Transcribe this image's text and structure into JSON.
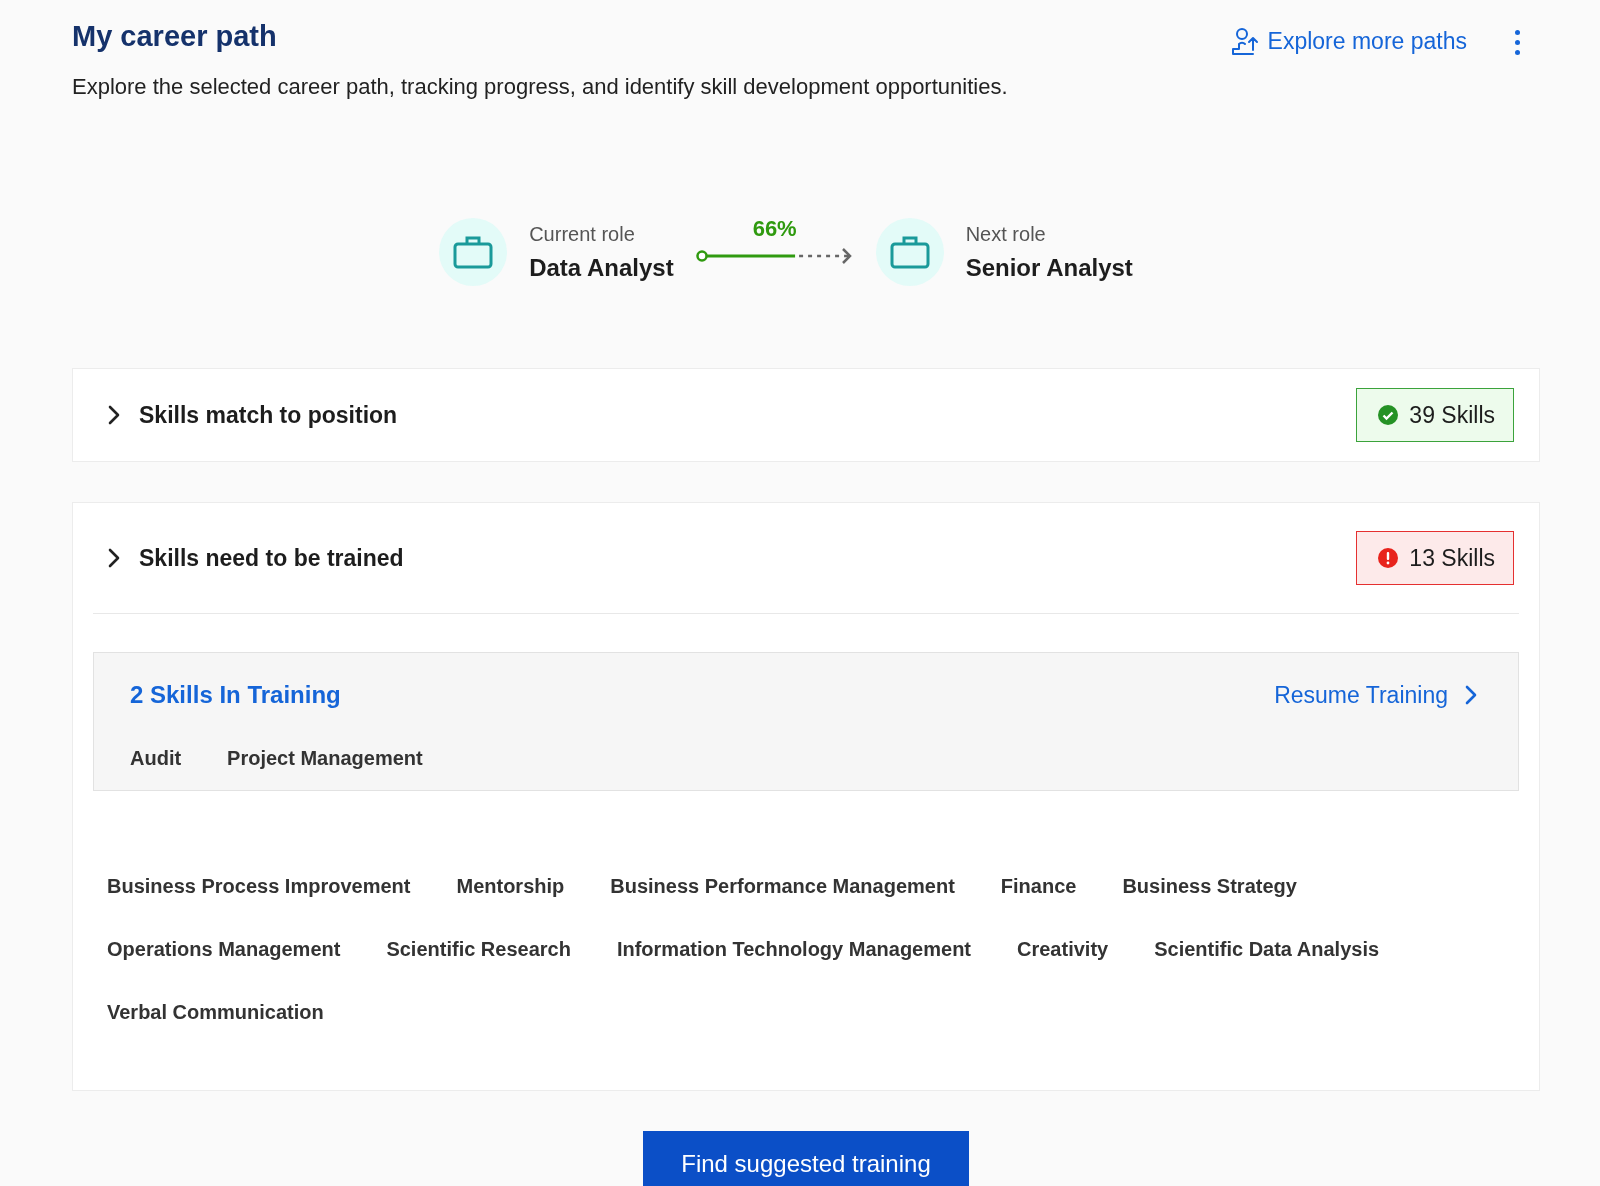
{
  "header": {
    "title": "My career path",
    "subtitle": "Explore the selected career path, tracking progress, and identify skill development opportunities.",
    "explore_link": "Explore more paths"
  },
  "path": {
    "current": {
      "label": "Current role",
      "title": "Data Analyst"
    },
    "progress": {
      "reading": "66%",
      "level": 0.66
    },
    "next": {
      "label": "Next role",
      "title": "Senior Analyst"
    }
  },
  "sections": [
    {
      "title": "Skills match to position",
      "badge": {
        "text": "39 Skills",
        "kind": "success"
      }
    },
    {
      "title": "Skills need to be trained",
      "badge": {
        "text": "13 Skills",
        "kind": "error"
      },
      "training": {
        "title": "2 Skills In Training",
        "link": "Resume Training",
        "skills": [
          "Audit",
          "Project Management"
        ]
      },
      "skills": [
        "Business Process Improvement",
        "Mentorship",
        "Business Performance Management",
        "Finance",
        "Business Strategy",
        "Operations Management",
        "Scientific Research",
        "Information Technology Management",
        "Creativity",
        "Scientific Data Analysis",
        "Verbal Communication"
      ]
    }
  ],
  "primary_button": "Find suggested training"
}
